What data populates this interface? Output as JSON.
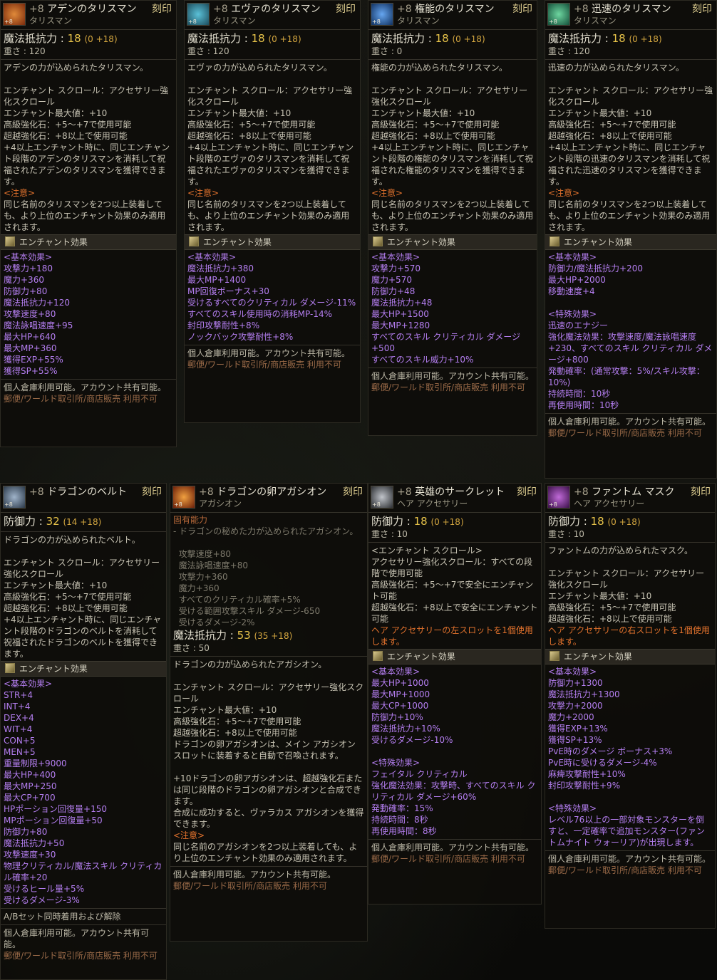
{
  "seal_label": "刻印",
  "enchant_effect_label": "エンチャント効果",
  "cards": [
    {
      "id": "aden",
      "icon_color": "#b2561f",
      "enchant": "+8",
      "name": "アデンのタリスマン",
      "type": "タリスマン",
      "stat_label": "魔法抵抗力 :",
      "stat_value": "18",
      "stat_sub": "(0 +18)",
      "weight": "重さ : 120",
      "desc": "アデンの力が込められたタリスマン。\n\nエンチャント スクロール：アクセサリー強化スクロール\nエンチャント最大値：+10\n高級強化石：+5～+7で使用可能\n超越強化石：+8以上で使用可能\n+4以上エンチャント時に、同じエンチャント段階のアデンのタリスマンを消耗して祝福されたアデンのタリスマンを獲得できます。\n",
      "warn_title": "<注意>",
      "warn_text": "同じ名前のタリスマンを2つ以上装着しても、より上位のエンチャント効果のみ適用されます。",
      "effects": "<基本効果>\n攻撃力+180\n魔力+360\n防御力+80\n魔法抵抗力+120\n攻撃速度+80\n魔法詠唱速度+95\n最大HP+640\n最大MP+360\n獲得EXP+55%\n獲得SP+55%",
      "footer": "個人倉庫利用可能。アカウント共有可能。",
      "footer2": "郵便/ワールド取引所/商店販売 利用不可"
    },
    {
      "id": "eva",
      "icon_color": "#2c7f96",
      "enchant": "+8",
      "name": "エヴァのタリスマン",
      "type": "タリスマン",
      "stat_label": "魔法抵抗力 :",
      "stat_value": "18",
      "stat_sub": "(0 +18)",
      "weight": "重さ : 120",
      "desc": "エヴァの力が込められたタリスマン。\n\nエンチャント スクロール：アクセサリー強化スクロール\nエンチャント最大値：+10\n高級強化石：+5～+7で使用可能\n超越強化石：+8以上で使用可能\n+4以上エンチャント時に、同じエンチャント段階のエヴァのタリスマンを消耗して祝福されたエヴァのタリスマンを獲得できます。\n",
      "warn_title": "<注意>",
      "warn_text": "同じ名前のタリスマンを2つ以上装着しても、より上位のエンチャント効果のみ適用されます。",
      "effects": "<基本効果>\n魔法抵抗力+380\n最大MP+1400\nMP回復ボーナス+30\n受けるすべてのクリティカル ダメージ-11%\nすべてのスキル使用時の消耗MP-14%\n封印攻撃耐性+8%\nノックバック攻撃耐性+8%",
      "footer": "個人倉庫利用可能。アカウント共有可能。",
      "footer2": "郵便/ワールド取引所/商店販売 利用不可"
    },
    {
      "id": "authority",
      "icon_color": "#1f64b0",
      "enchant": "+8",
      "name": "権能のタリスマン",
      "type": "タリスマン",
      "stat_label": "魔法抵抗力 :",
      "stat_value": "18",
      "stat_sub": "(0 +18)",
      "weight": "重さ : 0",
      "desc": "権能の力が込められたタリスマン。\n\nエンチャント スクロール：アクセサリー強化スクロール\nエンチャント最大値：+10\n高級強化石：+5～+7で使用可能\n超越強化石：+8以上で使用可能\n+4以上エンチャント時に、同じエンチャント段階の権能のタリスマンを消耗して祝福された権能のタリスマンを獲得できます。\n",
      "warn_title": "<注意>",
      "warn_text": "同じ名前のタリスマンを2つ以上装着しても、より上位のエンチャント効果のみ適用されます。",
      "effects": "<基本効果>\n攻撃力+570\n魔力+570\n防御力+48\n魔法抵抗力+48\n最大HP+1500\n最大MP+1280\nすべてのスキル クリティカル ダメージ+500\nすべてのスキル威力+10%",
      "footer": "個人倉庫利用可能。アカウント共有可能。",
      "footer2": "郵便/ワールド取引所/商店販売 利用不可"
    },
    {
      "id": "swift",
      "icon_color": "#2f8b66",
      "enchant": "+8",
      "name": "迅速のタリスマン",
      "type": "タリスマン",
      "stat_label": "魔法抵抗力 :",
      "stat_value": "18",
      "stat_sub": "(0 +18)",
      "weight": "重さ : 120",
      "desc": "迅速の力が込められたタリスマン。\n\nエンチャント スクロール：アクセサリー強化スクロール\nエンチャント最大値：+10\n高級強化石：+5～+7で使用可能\n超越強化石：+8以上で使用可能\n+4以上エンチャント時に、同じエンチャント段階の迅速のタリスマンを消耗して祝福された迅速のタリスマンを獲得できます。\n",
      "warn_title": "<注意>",
      "warn_text": "同じ名前のタリスマンを2つ以上装着しても、より上位のエンチャント効果のみ適用されます。",
      "effects": "<基本効果>\n防御力/魔法抵抗力+200\n最大HP+2000\n移動速度+4\n\n<特殊効果>\n迅速のエナジー\n強化魔法効果：攻撃速度/魔法詠唱速度+230、すべてのスキル クリティカル ダメージ+800\n発動確率：(通常攻撃：5%/スキル攻撃：10%)\n持続時間：10秒\n再使用時間：10秒",
      "footer": "個人倉庫利用可能。アカウント共有可能。",
      "footer2": "郵便/ワールド取引所/商店販売 利用不可"
    },
    {
      "id": "belt",
      "icon_color": "#5a6f88",
      "enchant": "+8",
      "name": "ドラゴンのベルト",
      "type": "",
      "stat_label": "防御力 :",
      "stat_value": "32",
      "stat_sub": "(14 +18)",
      "weight": "",
      "desc": "ドラゴンの力が込められたベルト。\n\nエンチャント スクロール：アクセサリー強化スクロール\nエンチャント最大値：+10\n高級強化石：+5～+7で使用可能\n超越強化石：+8以上で使用可能\n+4以上エンチャント時に、同じエンチャント段階のドラゴンのベルトを消耗して祝福されたドラゴンのベルトを獲得できます。",
      "warn_title": "",
      "warn_text": "",
      "effects": "<基本効果>\nSTR+4\nINT+4\nDEX+4\nWIT+4\nCON+5\nMEN+5\n重量制限+9000\n最大HP+400\n最大MP+250\n最大CP+700\nHPポーション回復量+150\nMPポーション回復量+50\n防御力+80\n魔法抵抗力+50\n攻撃速度+30\n物理クリティカル/魔法スキル クリティカル確率+20\n受けるヒール量+5%\n受けるダメージ-3%",
      "extra": "A/Bセット同時着用および解除",
      "footer": "個人倉庫利用可能。アカウント共有可能。",
      "footer2": "郵便/ワールド取引所/商店販売 利用不可"
    },
    {
      "id": "agathion",
      "icon_color": "#c4531b",
      "enchant": "+8",
      "name": "ドラゴンの卵アガシオン",
      "type": "アガシオン",
      "inherent_title": "固有能力",
      "inherent_text": "- ドラゴンの秘めた力が込められたアガシオン。\n\n  攻撃速度+80\n  魔法詠唱速度+80\n  攻撃力+360\n  魔力+360\n  すべてのクリティカル確率+5%\n  受ける範囲攻撃スキル ダメージ-650\n  受けるダメージ-2%",
      "stat_label": "魔法抵抗力 :",
      "stat_value": "53",
      "stat_sub": "(35 +18)",
      "weight": "重さ : 50",
      "desc": "ドラゴンの力が込められたアガシオン。\n\nエンチャント スクロール：アクセサリー強化スクロール\nエンチャント最大値：+10\n高級強化石：+5～+7で使用可能\n超越強化石：+8以上で使用可能\nドラゴンの卵アガシオンは、メイン アガシオン スロットに装着すると自動で召喚されます。\n\n+10ドラゴンの卵アガシオンは、超越強化石または同じ段階のドラゴンの卵アガシオンと合成できます。\n合成に成功すると、ヴァラカス アガシオンを獲得できます。\n",
      "warn_title": "<注意>",
      "warn_text": "同じ名前のアガシオンを2つ以上装着しても、より上位のエンチャント効果のみ適用されます。",
      "footer": "個人倉庫利用可能。アカウント共有可能。",
      "footer2": "郵便/ワールド取引所/商店販売 利用不可"
    },
    {
      "id": "circlet",
      "icon_color": "#6b6f74",
      "enchant": "+8",
      "name": "英雄のサークレット",
      "type": "ヘア アクセサリー",
      "stat_label": "防御力 :",
      "stat_value": "18",
      "stat_sub": "(0 +18)",
      "weight": "重さ : 10",
      "desc": "<エンチャント スクロール>\nアクセサリー強化スクロール：すべての段階で使用可能\n高級強化石：+5～+7で安全にエンチャント可能\n超越強化石：+8以上で安全にエンチャント可能\n",
      "warn_title": "",
      "warn_text": "ヘア アクセサリーの左スロットを1個使用します。",
      "effects": "<基本効果>\n最大HP+1000\n最大MP+1000\n最大CP+1000\n防御力+10%\n魔法抵抗力+10%\n受けるダメージ-10%\n\n<特殊効果>\nフェイタル クリティカル\n強化魔法効果：攻撃時、すべてのスキル クリティカル ダメージ+60%\n発動確率：15%\n持続時間：8秒\n再使用時間：8秒",
      "footer": "個人倉庫利用可能。アカウント共有可能。",
      "footer2": "郵便/ワールド取引所/商店販売 利用不可"
    },
    {
      "id": "phantom",
      "icon_color": "#7a2f8f",
      "enchant": "+8",
      "name": "ファントム マスク",
      "type": "ヘア アクセサリー",
      "stat_label": "防御力 :",
      "stat_value": "18",
      "stat_sub": "(0 +18)",
      "weight": "重さ : 10",
      "desc": "ファントムの力が込められたマスク。\n\nエンチャント スクロール：アクセサリー強化スクロール\nエンチャント最大値：+10\n高級強化石：+5～+7で使用可能\n超越強化石：+8以上で使用可能\n",
      "warn_title": "",
      "warn_text": "ヘア アクセサリーの右スロットを1個使用します。",
      "effects": "<基本効果>\n防御力+1300\n魔法抵抗力+1300\n攻撃力+2000\n魔力+2000\n獲得EXP+13%\n獲得SP+13%\nPvE時のダメージ ボーナス+3%\nPvE時に受けるダメージ-4%\n麻痺攻撃耐性+10%\n封印攻撃耐性+9%\n\n<特殊効果>\nレベル76以上の一部対象モンスターを倒すと、一定確率で追加モンスター(ファントムナイト ウォーリア)が出現します。",
      "footer": "個人倉庫利用可能。アカウント共有可能。",
      "footer2": "郵便/ワールド取引所/商店販売 利用不可"
    }
  ]
}
